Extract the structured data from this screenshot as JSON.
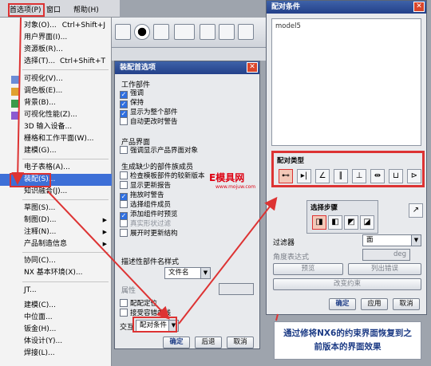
{
  "menubar": {
    "items": [
      "首选项(P)",
      "窗口",
      "帮助(H)"
    ]
  },
  "prefs_menu": {
    "items": [
      {
        "label": "对象(O)...",
        "shortcut": "Ctrl+Shift+J"
      },
      {
        "label": "用户界面(I)...",
        "shortcut": ""
      },
      {
        "label": "资源板(R)...",
        "shortcut": ""
      },
      {
        "label": "选择(T)...",
        "shortcut": "Ctrl+Shift+T"
      },
      {
        "label": "可视化(V)...",
        "shortcut": ""
      },
      {
        "label": "调色板(E)...",
        "shortcut": ""
      },
      {
        "label": "背景(B)...",
        "shortcut": ""
      },
      {
        "label": "可视化性能(Z)...",
        "shortcut": ""
      },
      {
        "label": "3D 输入设备...",
        "shortcut": ""
      },
      {
        "label": "栅格和工作平面(W)...",
        "shortcut": ""
      },
      {
        "label": "建模(G)...",
        "shortcut": ""
      },
      {
        "label": "电子表格(A)...",
        "shortcut": ""
      },
      {
        "label": "装配(S)...",
        "shortcut": ""
      },
      {
        "label": "知识融合(J)...",
        "shortcut": ""
      },
      {
        "label": "草图(S)...",
        "shortcut": ""
      },
      {
        "label": "制图(D)...",
        "shortcut": ""
      },
      {
        "label": "注释(N)...",
        "shortcut": ""
      },
      {
        "label": "产品制造信息",
        "shortcut": ""
      },
      {
        "label": "协同(C)...",
        "shortcut": ""
      },
      {
        "label": "NX 基本环境(X)...",
        "shortcut": ""
      },
      {
        "label": "JT...",
        "shortcut": ""
      },
      {
        "label": "建模(C)...",
        "shortcut": ""
      },
      {
        "label": "中位面...",
        "shortcut": ""
      },
      {
        "label": "钣金(H)...",
        "shortcut": ""
      },
      {
        "label": "体设计(Y)...",
        "shortcut": ""
      },
      {
        "label": "焊接(L)...",
        "shortcut": ""
      }
    ]
  },
  "assembly_dialog": {
    "title": "装配首选项",
    "sections": {
      "work_part": "工作部件",
      "product_interface": "产品界面",
      "generate_missing": "生成缺少的部件族成员",
      "description": "描述性部件名样式"
    },
    "checks": [
      {
        "label": "强调",
        "checked": "✓"
      },
      {
        "label": "保持",
        "checked": "✓"
      },
      {
        "label": "显示为整个部件",
        "checked": "✓"
      },
      {
        "label": "自动更改时警告",
        "checked": ""
      },
      {
        "label": "强调显示产品界面对象",
        "checked": ""
      },
      {
        "label": "检查模板部件的较新版本",
        "checked": ""
      },
      {
        "label": "显示更新报告",
        "checked": ""
      },
      {
        "label": "拖放时警告",
        "checked": "✓"
      },
      {
        "label": "选择组件成员",
        "checked": ""
      },
      {
        "label": "添加组件时预览",
        "checked": "✓"
      },
      {
        "label": "真实形状过滤",
        "checked": ""
      },
      {
        "label": "展开时更新结构",
        "checked": ""
      }
    ],
    "name_style": "文件名",
    "attribute_label": "属性",
    "mate_position": "配配定位",
    "accept_curve": "接受容错曲线",
    "interaction_label": "交互",
    "interaction_value": "配对条件",
    "ok": "确定",
    "back": "后退",
    "cancel": "取消"
  },
  "constraint_panel": {
    "title": "配对条件",
    "tree_item": "model5",
    "mate_type_label": "配对类型",
    "types": [
      "⊷",
      "▸|",
      "∠",
      "∥",
      "⊥",
      "⇹",
      "⊔",
      "⊳"
    ],
    "select_step_label": "选择步骤",
    "filter_label": "过滤器",
    "filter_value": "面",
    "angle_label": "角度表达式",
    "angle_unit": "deg",
    "preview": "预览",
    "list_errors": "列出错误",
    "change_constraint": "改变约束",
    "ok": "确定",
    "apply": "应用",
    "cancel": "取消"
  },
  "watermark": "E模具网",
  "watermark_sub": "www.mojuw.com",
  "note": "通过修将NX6的约束界面恢复到之前版本的界面效果"
}
